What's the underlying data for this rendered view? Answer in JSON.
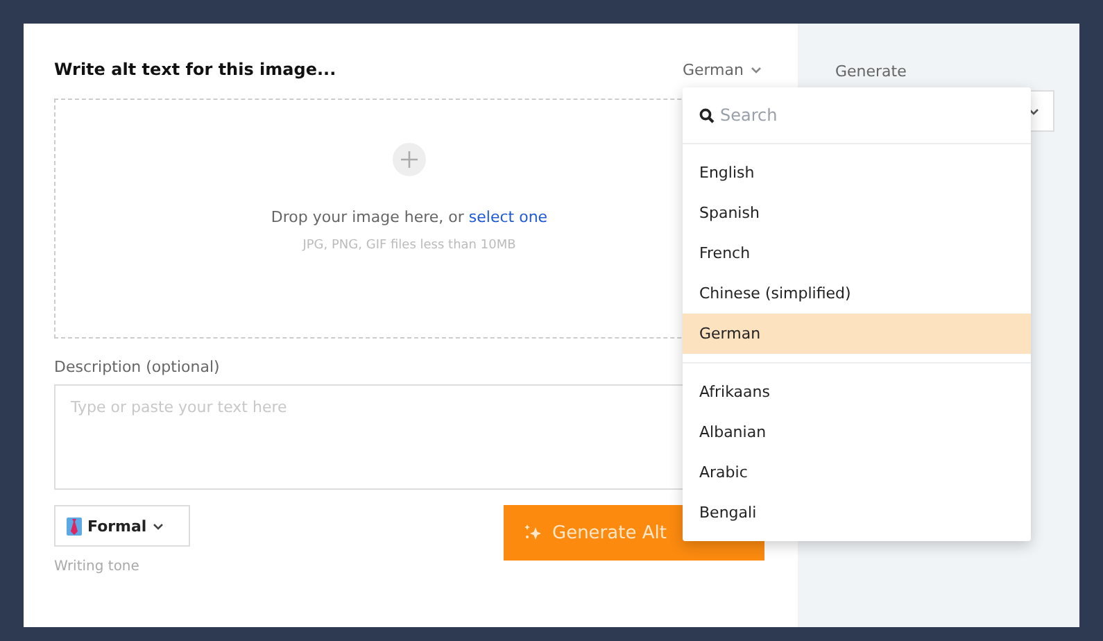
{
  "title": "Write alt text for this image...",
  "language_select": {
    "value": "German"
  },
  "drop_zone": {
    "text": "Drop your image here, or ",
    "link": "select one",
    "hint": "JPG, PNG, GIF files less than 10MB"
  },
  "description": {
    "label": "Description (optional)",
    "placeholder": "Type or paste your text here"
  },
  "tone": {
    "value": "Formal",
    "label": "Writing tone"
  },
  "generate_button": {
    "label": "Generate Alt"
  },
  "side_panel": {
    "label": "Generate"
  },
  "language_menu": {
    "search_placeholder": "Search",
    "groups": [
      {
        "items": [
          {
            "label": "English",
            "selected": false
          },
          {
            "label": "Spanish",
            "selected": false
          },
          {
            "label": "French",
            "selected": false
          },
          {
            "label": "Chinese (simplified)",
            "selected": false
          },
          {
            "label": "German",
            "selected": true
          }
        ]
      },
      {
        "items": [
          {
            "label": "Afrikaans",
            "selected": false
          },
          {
            "label": "Albanian",
            "selected": false
          },
          {
            "label": "Arabic",
            "selected": false
          },
          {
            "label": "Bengali",
            "selected": false
          }
        ]
      }
    ]
  }
}
